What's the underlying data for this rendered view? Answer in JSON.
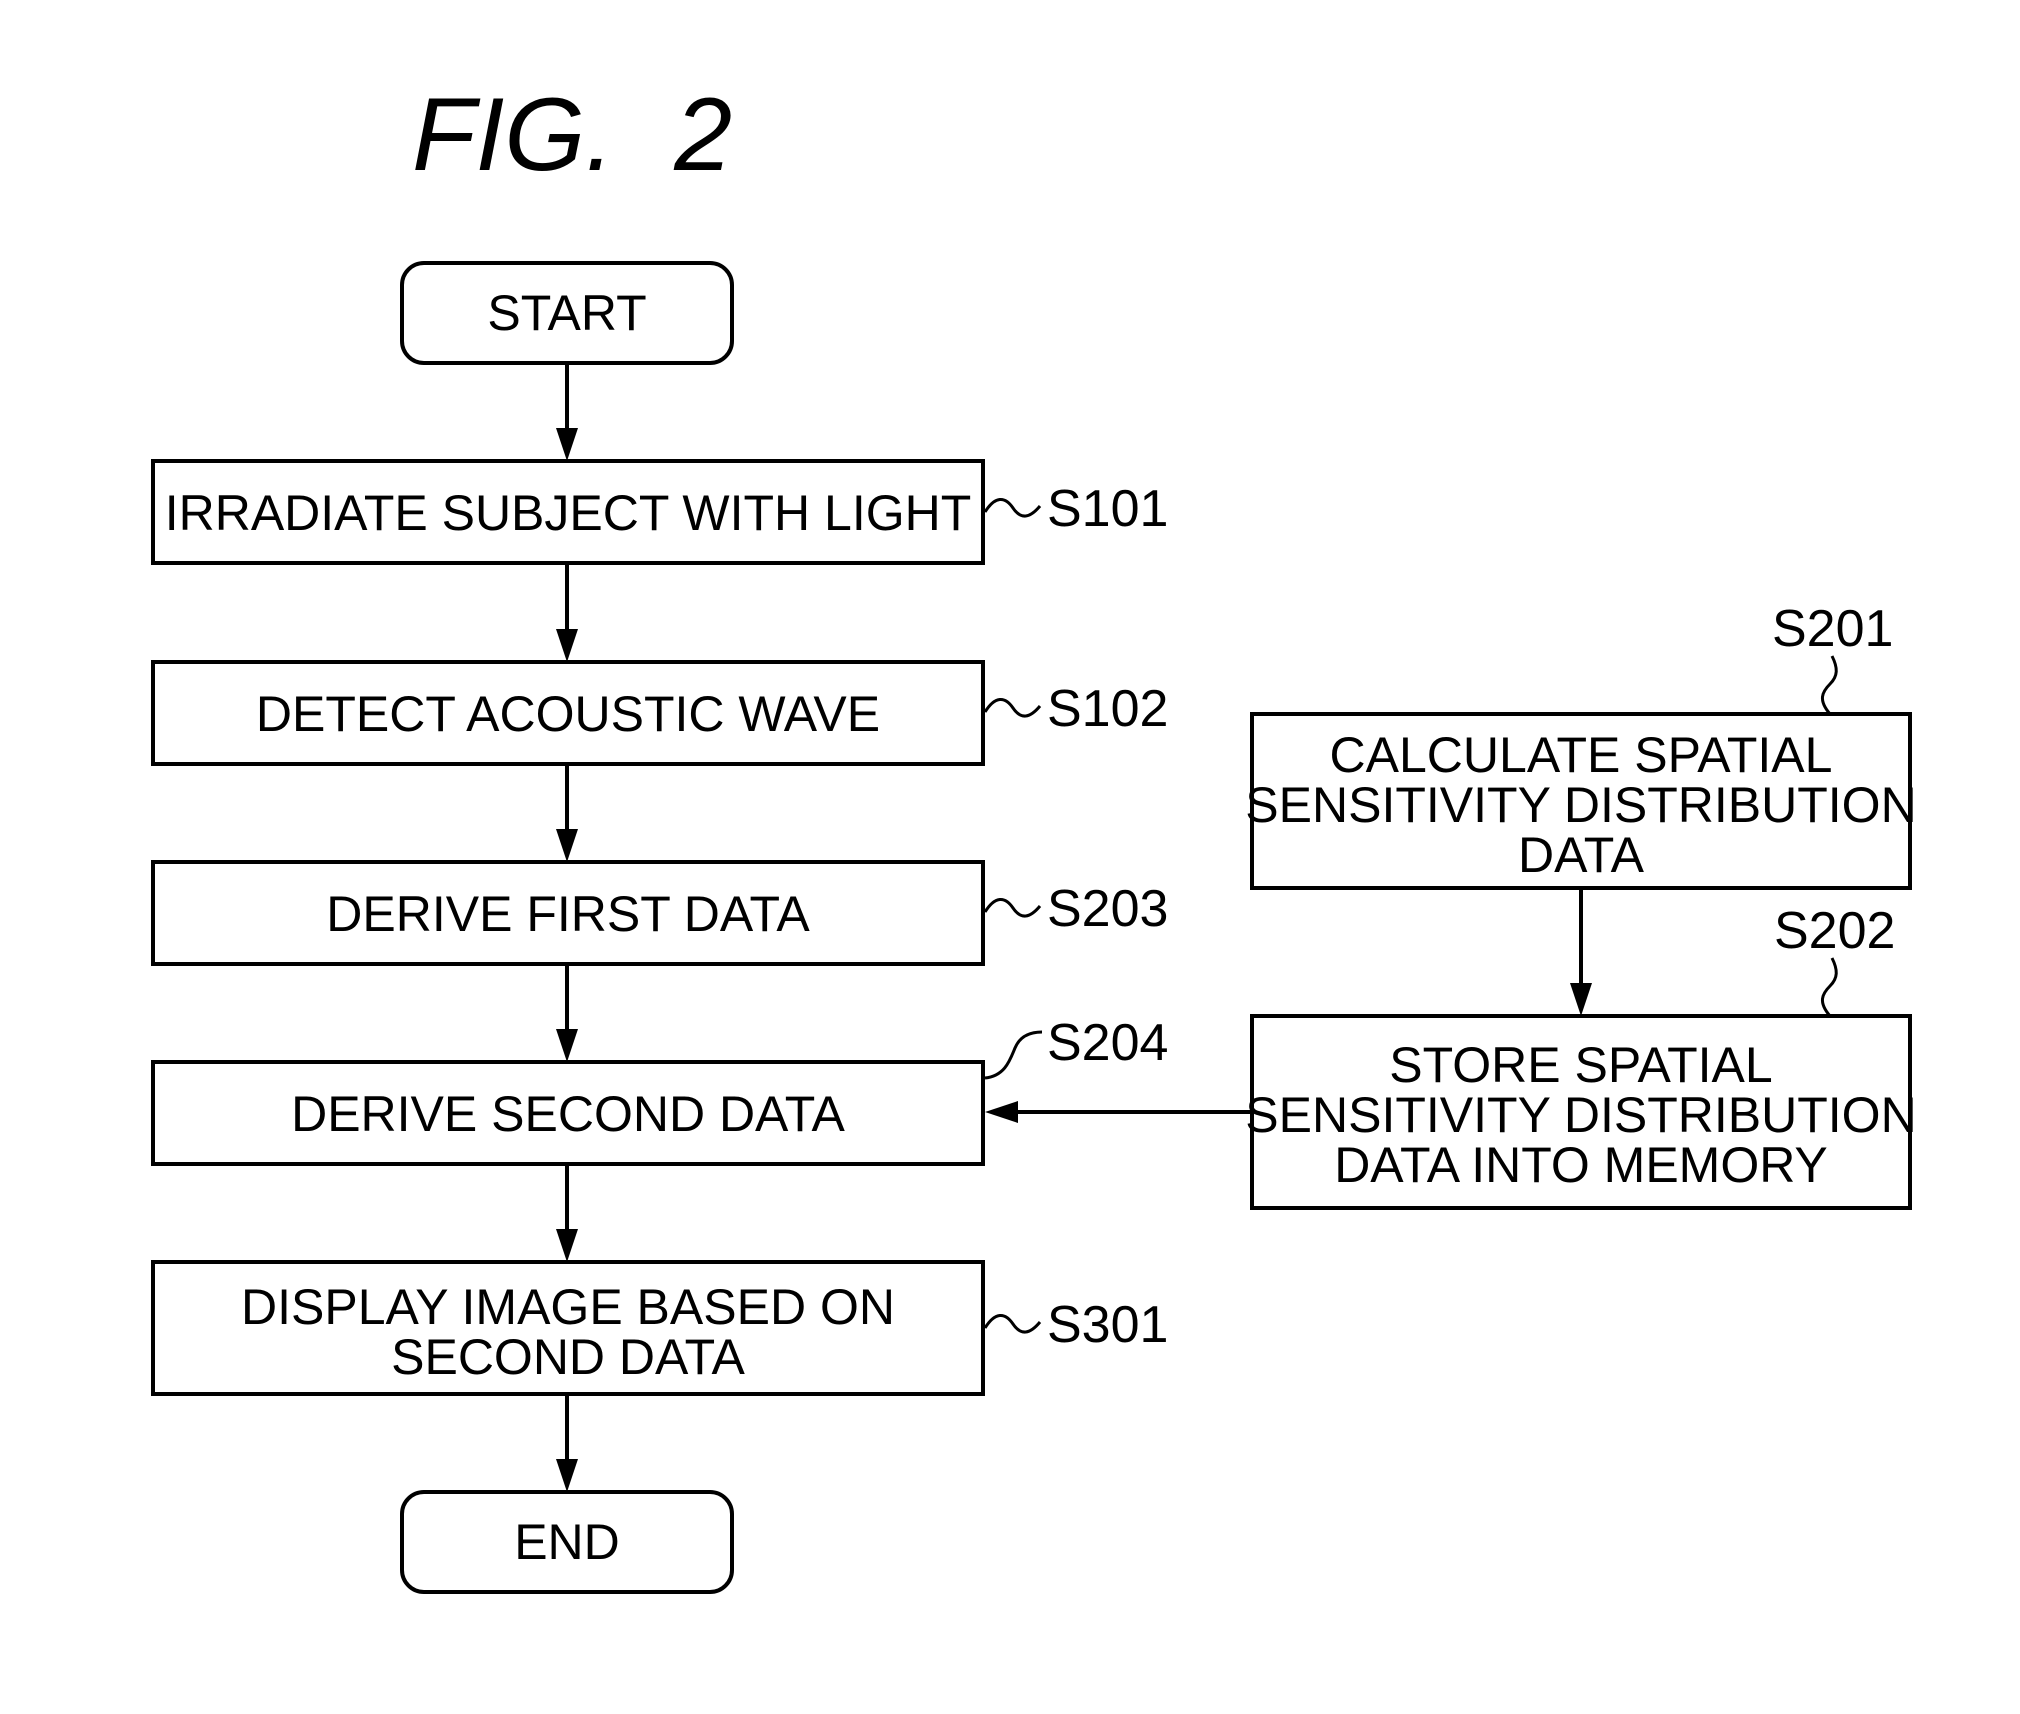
{
  "figure": {
    "title": "FIG.",
    "number": "2"
  },
  "nodes": {
    "start": {
      "text": "START"
    },
    "s101": {
      "label": "S101",
      "lines": [
        "IRRADIATE SUBJECT WITH LIGHT"
      ]
    },
    "s102": {
      "label": "S102",
      "lines": [
        "DETECT ACOUSTIC WAVE"
      ]
    },
    "s203": {
      "label": "S203",
      "lines": [
        "DERIVE FIRST DATA"
      ]
    },
    "s204": {
      "label": "S204",
      "lines": [
        "DERIVE SECOND DATA"
      ]
    },
    "s301": {
      "label": "S301",
      "lines": [
        "DISPLAY IMAGE BASED ON",
        "SECOND DATA"
      ]
    },
    "end": {
      "text": "END"
    },
    "s201": {
      "label": "S201",
      "lines": [
        "CALCULATE SPATIAL",
        "SENSITIVITY DISTRIBUTION",
        "DATA"
      ]
    },
    "s202": {
      "label": "S202",
      "lines": [
        "STORE SPATIAL",
        "SENSITIVITY DISTRIBUTION",
        "DATA INTO MEMORY"
      ]
    }
  },
  "edges": [
    {
      "from": "start",
      "to": "s101"
    },
    {
      "from": "s101",
      "to": "s102"
    },
    {
      "from": "s102",
      "to": "s203"
    },
    {
      "from": "s203",
      "to": "s204"
    },
    {
      "from": "s204",
      "to": "s301"
    },
    {
      "from": "s301",
      "to": "end"
    },
    {
      "from": "s201",
      "to": "s202"
    },
    {
      "from": "s202",
      "to": "s204"
    }
  ]
}
